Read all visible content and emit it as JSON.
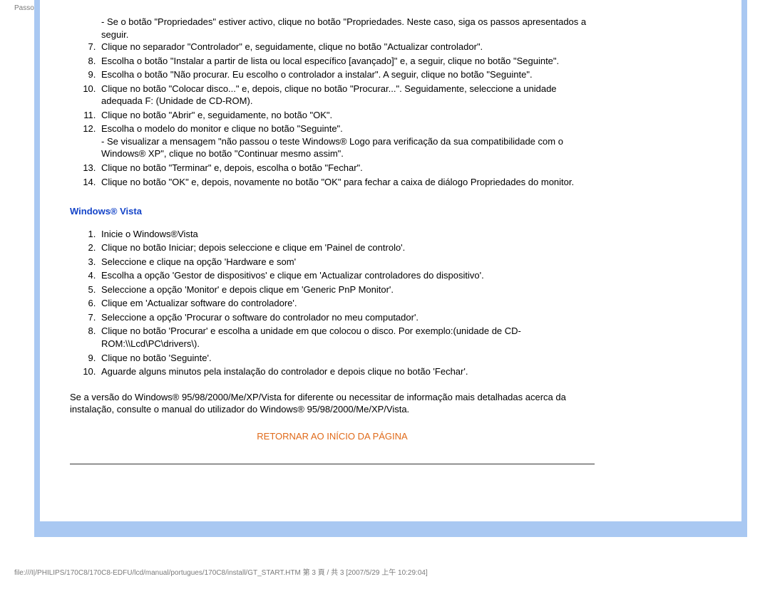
{
  "header_label": "Passos Iniciais",
  "pre_items": [
    "- Se o botão \"Propriedades\" estiver activo, clique no botão \"Propriedades. Neste caso, siga os passos apresentados a seguir."
  ],
  "list1_start": 7,
  "list1": [
    {
      "text": "Clique no separador \"Controlador\" e, seguidamente, clique no botão \"Actualizar controlador\"."
    },
    {
      "text": "Escolha o botão \"Instalar a partir de lista ou local específico [avançado]\" e, a seguir, clique no botão \"Seguinte\"."
    },
    {
      "text": "Escolha o botão \"Não procurar. Eu escolho o controlador a instalar\". A seguir, clique no botão \"Seguinte\"."
    },
    {
      "text": "Clique no botão \"Colocar disco...\" e, depois, clique no botão \"Procurar...\". Seguidamente, seleccione a unidade adequada F: (Unidade de CD-ROM)."
    },
    {
      "text": "Clique no botão \"Abrir\" e, seguidamente, no botão \"OK\"."
    },
    {
      "text": "Escolha o modelo do monitor e clique no botão \"Seguinte\".",
      "sub": "- Se visualizar a mensagem \"não passou o teste Windows® Logo para verificação da sua compatibilidade com o Windows® XP\", clique no botão \"Continuar mesmo assim\"."
    },
    {
      "text": "Clique no botão \"Terminar\" e, depois, escolha o botão \"Fechar\"."
    },
    {
      "text": "Clique no botão \"OK\" e, depois, novamente no botão \"OK\" para fechar a caixa de diálogo Propriedades do monitor."
    }
  ],
  "vista_title": "Windows® Vista",
  "list2_start": 1,
  "list2": [
    {
      "text": "Inicie o Windows®Vista"
    },
    {
      "text": "Clique no botão Iniciar; depois seleccione e clique em 'Painel de controlo'."
    },
    {
      "text": "Seleccione e clique na opção 'Hardware e som'"
    },
    {
      "text": "Escolha a opção 'Gestor de dispositivos' e clique em 'Actualizar controladores do dispositivo'."
    },
    {
      "text": "Seleccione a opção 'Monitor' e depois clique em 'Generic PnP Monitor'."
    },
    {
      "text": "Clique em 'Actualizar software do controladore'."
    },
    {
      "text": "Seleccione a opção 'Procurar o software do controlador no meu computador'."
    },
    {
      "text": "Clique no botão 'Procurar' e escolha a unidade em que colocou o disco. Por exemplo:(unidade de CD-ROM:\\\\Lcd\\PC\\drivers\\)."
    },
    {
      "text": "Clique no botão 'Seguinte'."
    },
    {
      "text": "Aguarde alguns minutos pela instalação do controlador e depois clique no botão 'Fechar'."
    }
  ],
  "closing_para": "Se a versão do Windows® 95/98/2000/Me/XP/Vista for diferente ou necessitar de informação mais detalhadas acerca da instalação, consulte o manual do utilizador do Windows® 95/98/2000/Me/XP/Vista.",
  "return_link": "RETORNAR AO INÍCIO DA PÁGINA",
  "footer": "file:///I|/PHILIPS/170C8/170C8-EDFU/lcd/manual/portugues/170C8/install/GT_START.HTM 第 3 頁 / 共 3  [2007/5/29 上午 10:29:04]"
}
